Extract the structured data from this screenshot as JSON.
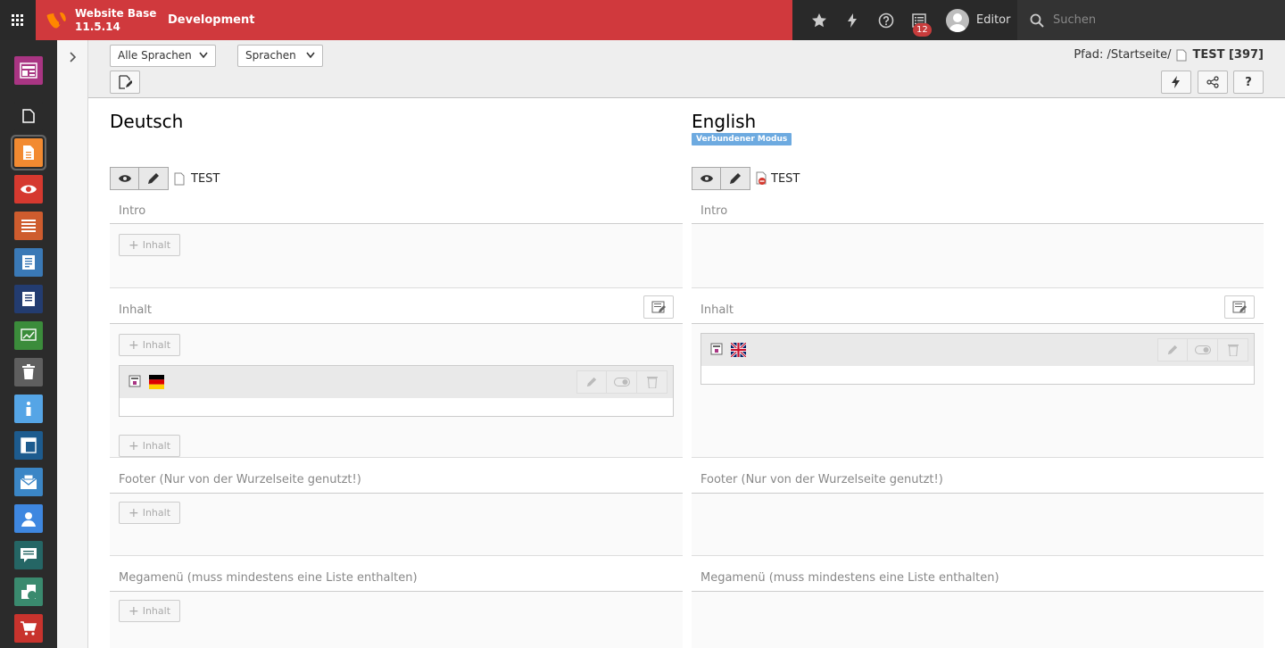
{
  "topbar": {
    "site_name": "Website Base",
    "version": "11.5.14",
    "context": "Development",
    "notification_count": "12",
    "user_name": "Editor",
    "search_placeholder": "Suchen"
  },
  "modules": [
    {
      "name": "module-web-layout-icon",
      "color": "#a93583"
    },
    {
      "name": "module-page-icon",
      "color": "#2b2b2b"
    },
    {
      "name": "module-page-list-icon",
      "color": "#f28a31"
    },
    {
      "name": "module-view-icon",
      "color": "#d5392f"
    },
    {
      "name": "module-list-icon",
      "color": "#ce5c2e"
    },
    {
      "name": "module-info-icon",
      "color": "#3a79b6"
    },
    {
      "name": "module-template-icon",
      "color": "#233c70"
    },
    {
      "name": "module-reports-icon",
      "color": "#3b8c3b"
    },
    {
      "name": "module-recycler-icon",
      "color": "#5f5f5f"
    },
    {
      "name": "module-about-icon",
      "color": "#55a5e6"
    },
    {
      "name": "module-layout-icon",
      "color": "#1d5b8e"
    },
    {
      "name": "module-newsletter-icon",
      "color": "#3b86c6"
    },
    {
      "name": "module-users-icon",
      "color": "#3e87e0"
    },
    {
      "name": "module-comments-icon",
      "color": "#256665"
    },
    {
      "name": "module-extensions-icon",
      "color": "#3a8a6e"
    },
    {
      "name": "module-shop-icon",
      "color": "#c8332d"
    }
  ],
  "docheader": {
    "language_select": "Alle Sprachen",
    "languages_select": "Sprachen",
    "path_label": "Pfad: /Startseite/",
    "page_title": "TEST [397]"
  },
  "columns": {
    "de": {
      "language": "Deutsch",
      "page_name": "TEST",
      "sections": {
        "intro": "Intro",
        "content": "Inhalt",
        "footer": "Footer (Nur von der Wurzelseite genutzt!)",
        "megamenu": "Megamenü (muss mindestens eine Liste enthalten)"
      },
      "add_label": "Inhalt"
    },
    "en": {
      "language": "English",
      "mode": "Verbundener Modus",
      "page_name": "TEST",
      "sections": {
        "intro": "Intro",
        "content": "Inhalt",
        "footer": "Footer (Nur von der Wurzelseite genutzt!)",
        "megamenu": "Megamenü (muss mindestens eine Liste enthalten)"
      }
    }
  }
}
